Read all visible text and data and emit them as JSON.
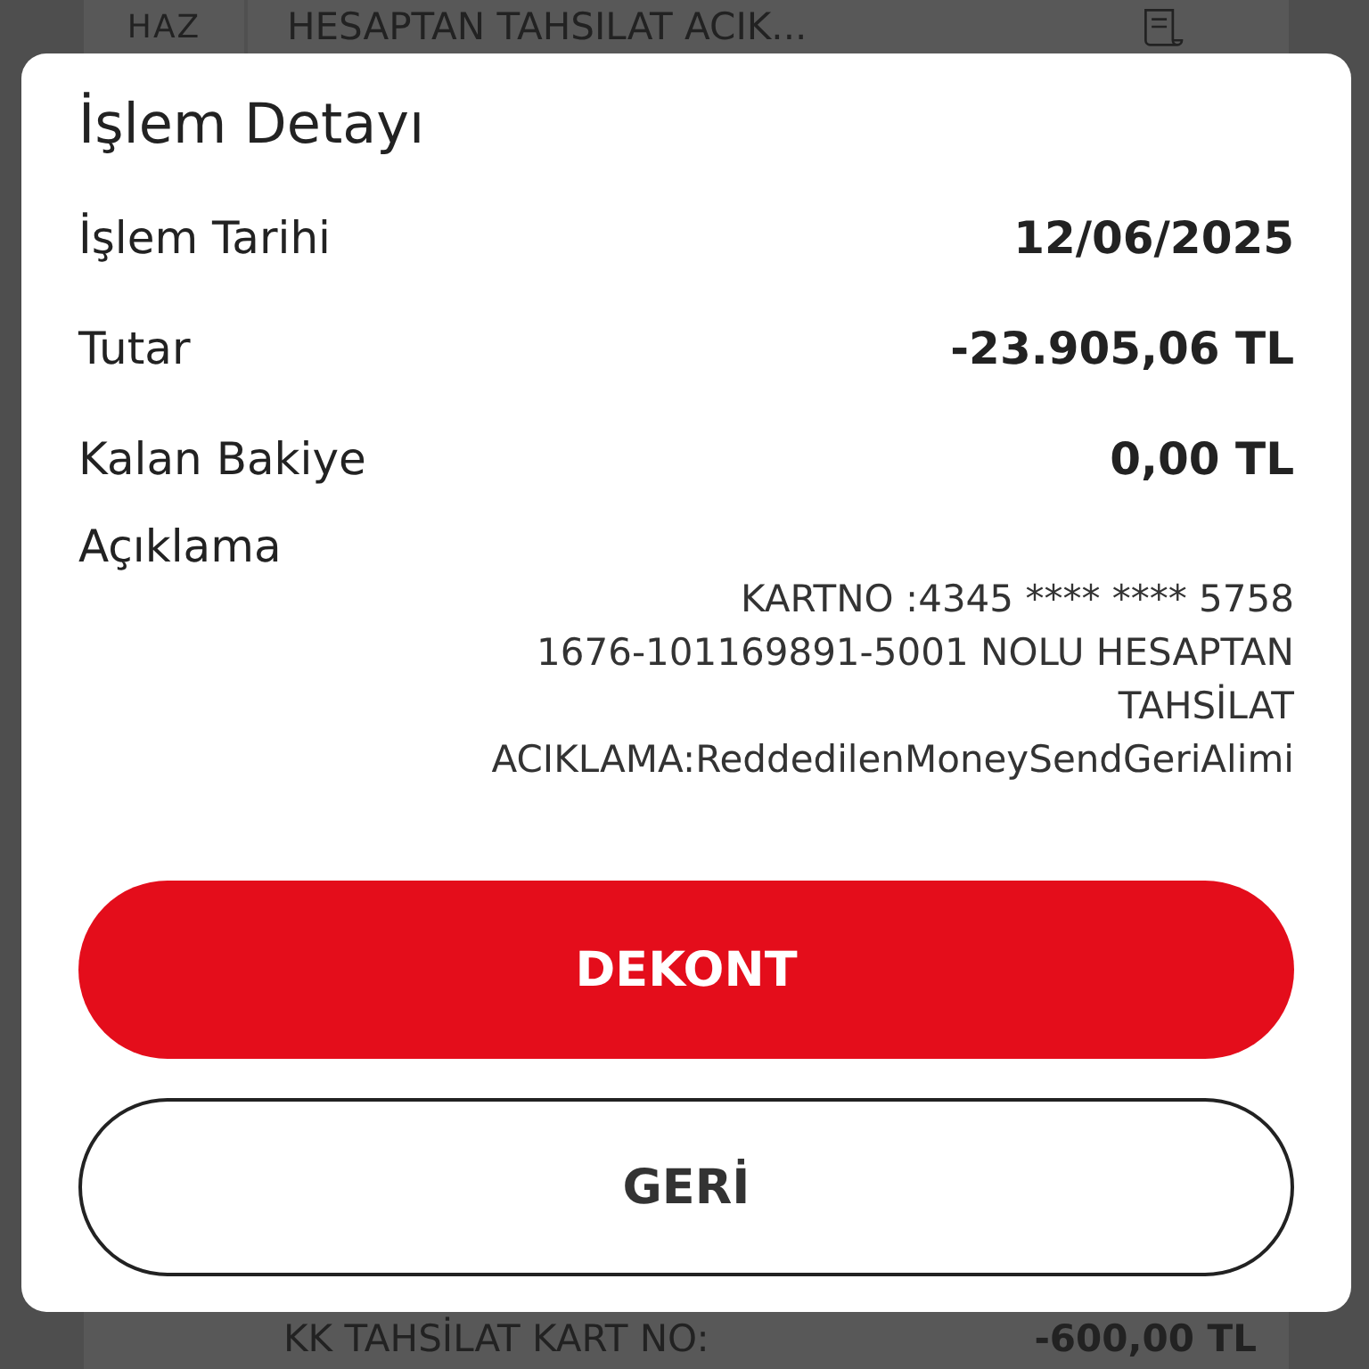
{
  "background_list": {
    "top_row": {
      "date": "HAZ",
      "description": "HESAPTAN TAHSILAT ACIK..."
    },
    "bottom_row": {
      "description": "KK TAHSİLAT KART NO:",
      "amount": "-600,00 TL"
    }
  },
  "dialog": {
    "title": "İşlem Detayı",
    "fields": [
      {
        "label": "İşlem Tarihi",
        "value": "12/06/2025"
      },
      {
        "label": "Tutar",
        "value": "-23.905,06 TL"
      },
      {
        "label": "Kalan Bakiye",
        "value": "0,00 TL"
      }
    ],
    "description": {
      "label": "Açıklama",
      "lines": [
        "KARTNO :4345 **** **** 5758",
        "1676-101169891-5001 NOLU HESAPTAN",
        "TAHSİLAT",
        "ACIKLAMA:ReddedilenMoneySendGeriAlimi"
      ]
    },
    "buttons": [
      {
        "label": "DEKONT",
        "kind": "primary"
      },
      {
        "label": "GERİ",
        "kind": "secondary"
      }
    ]
  }
}
